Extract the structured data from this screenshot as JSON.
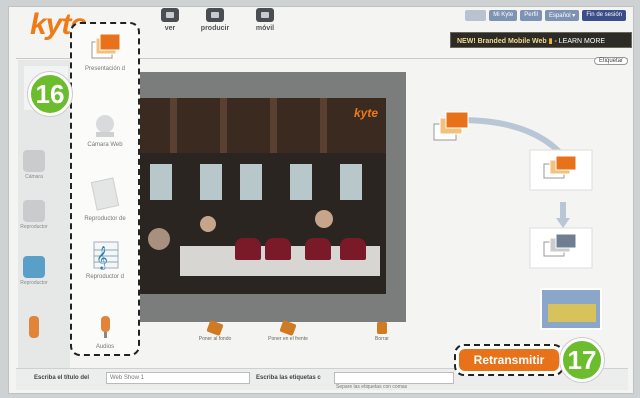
{
  "app": {
    "logo": "kyte"
  },
  "top_icons": [
    {
      "label": "ver",
      "icon": "tv-icon"
    },
    {
      "label": "producir",
      "icon": "monitor-icon"
    },
    {
      "label": "móvil",
      "icon": "mobile-icon"
    }
  ],
  "top_links": [
    {
      "label": "Mi Kyte"
    },
    {
      "label": "Perfil"
    },
    {
      "label": "Español ▾"
    },
    {
      "label": "Fin de sesión"
    }
  ],
  "promo": {
    "text": "NEW! Branded Mobile Web",
    "cta": "LEARN MORE"
  },
  "minimize_tab": "Etiquetar",
  "left_panel": [
    {
      "label": "Cámara"
    },
    {
      "label": "Reproductor"
    },
    {
      "label": "Reproductor"
    },
    {
      "label": ""
    }
  ],
  "toolbox": {
    "items": [
      {
        "label": "Presentación d",
        "icon": "slideshow-icon"
      },
      {
        "label": "Cámara Web",
        "icon": "webcam-icon"
      },
      {
        "label": "Reproductor de",
        "icon": "player-icon"
      },
      {
        "label": "Reproductor d",
        "icon": "music-player-icon"
      },
      {
        "label": "Audios",
        "icon": "microphone-icon"
      }
    ]
  },
  "video": {
    "watermark": "kyte"
  },
  "bottom_tools": [
    {
      "label": "Poner al fondo"
    },
    {
      "label": "Poner en el frente"
    },
    {
      "label": "Borrar"
    }
  ],
  "form": {
    "title_label": "Escriba el título del",
    "title_value": "Web Show 1",
    "tags_label": "Escriba las etiquetas c",
    "tags_hint": "Separe las etiquetas con comas"
  },
  "callouts": {
    "first": "16",
    "second": "17"
  },
  "broadcast_button": "Retransmitir",
  "colors": {
    "accent": "#e8721a",
    "badge": "#6cbd2e",
    "brand": "#ef7a18"
  }
}
